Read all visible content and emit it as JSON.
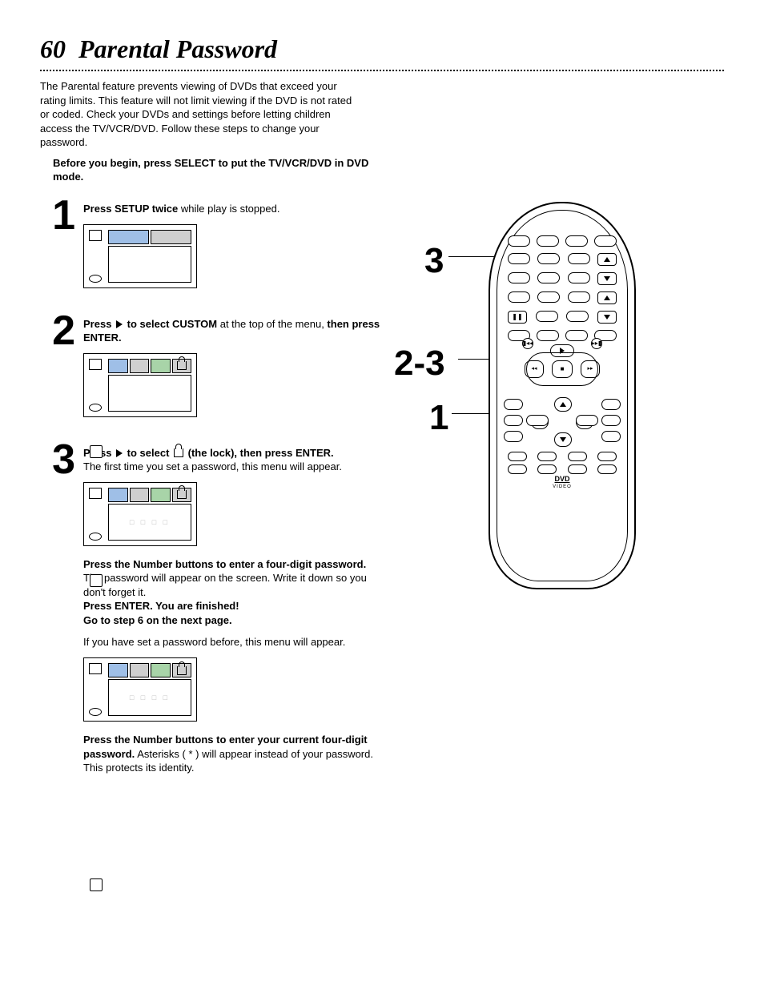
{
  "page_number": "60",
  "title": "Parental Password",
  "intro": "The Parental feature prevents viewing of DVDs that exceed your rating limits.  This feature will not limit viewing if the DVD is not rated or coded.  Check your DVDs and settings before letting children access the TV/VCR/DVD.  Follow these steps to change your password.",
  "preface_bold": "Before you begin, press SELECT to put the TV/VCR/DVD in DVD mode.",
  "step1": {
    "num": "1",
    "a": "Press SETUP twice",
    "b": " while play is stopped."
  },
  "step2": {
    "num": "2",
    "a": "Press ",
    "b": " to select CUSTOM",
    "c": " at the top of the menu, ",
    "d": "then press ENTER."
  },
  "step3": {
    "num": "3",
    "a": "Press ",
    "b": " to select ",
    "c": " (the lock), then press ENTER.",
    "d": "The first time you set a password, this menu will appear.",
    "e1": "Press the Number buttons to enter a four-digit password.",
    "e2": "  The password will appear on the screen.  Write it down so you don't forget it.",
    "f": "Press ENTER.  You are finished!",
    "g": "Go to step 6 on the next page.",
    "h": "If you have set a password before, this menu will appear.",
    "i1": "Press the Number buttons to enter your current four-digit password.",
    "i2": "  Asterisks ( * ) will appear instead of your password.  This protects its identity."
  },
  "remote": {
    "callout_3": "3",
    "callout_23": "2-3",
    "callout_1": "1",
    "dvd": "DVD",
    "dvd_sub": "VIDEO",
    "stop_glyph": "■",
    "rew": "◂◂",
    "ff": "▸▸",
    "prev": "▮◂◂",
    "next": "▸▸▮",
    "pause": "❚❚"
  },
  "pw_placeholder": "□ □ □ □"
}
